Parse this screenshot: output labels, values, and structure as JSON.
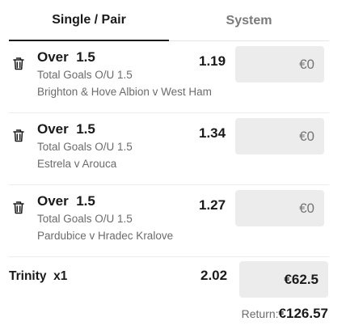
{
  "tabs": [
    {
      "label": "Single / Pair"
    },
    {
      "label": "System"
    }
  ],
  "bets": [
    {
      "selection": "Over  1.5",
      "market": "Total Goals O/U 1.5",
      "event": "Brighton & Hove Albion v West Ham",
      "odds": "1.19",
      "stake": "€0"
    },
    {
      "selection": "Over  1.5",
      "market": "Total Goals O/U 1.5",
      "event": "Estrela v Arouca",
      "odds": "1.34",
      "stake": "€0"
    },
    {
      "selection": "Over  1.5",
      "market": "Total Goals O/U 1.5",
      "event": "Pardubice v Hradec Kralove",
      "odds": "1.27",
      "stake": "€0"
    }
  ],
  "combo": {
    "label": "Trinity  x1",
    "odds": "2.02",
    "stake": "€62.5"
  },
  "return": {
    "label": "Return:",
    "value": "€126.57"
  },
  "icons": {
    "remove": "trash-icon"
  }
}
